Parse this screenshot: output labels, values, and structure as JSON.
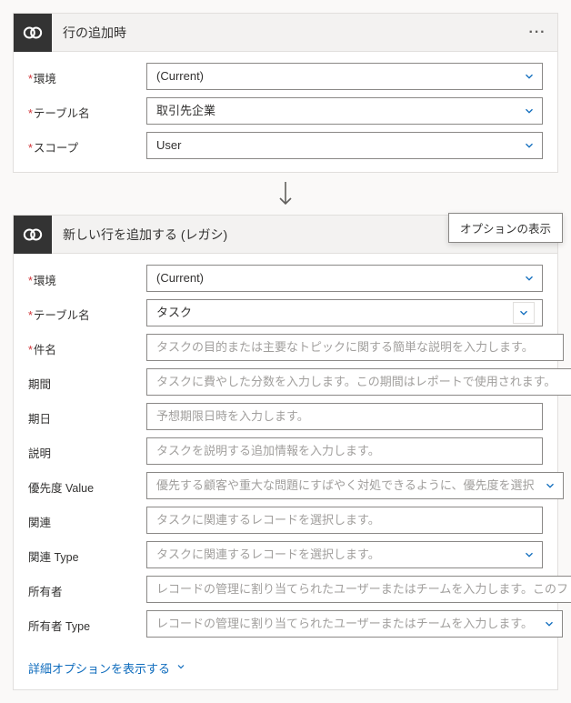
{
  "card1": {
    "title": "行の追加時",
    "fields": {
      "env": {
        "label": "環境",
        "value": "(Current)"
      },
      "table": {
        "label": "テーブル名",
        "value": "取引先企業"
      },
      "scope": {
        "label": "スコープ",
        "value": "User"
      }
    }
  },
  "card2": {
    "title": "新しい行を追加する (レガシ)",
    "tooltip": "オプションの表示",
    "fields": {
      "env": {
        "label": "環境",
        "value": "(Current)"
      },
      "table": {
        "label": "テーブル名",
        "value": "タスク"
      },
      "subject": {
        "label": "件名",
        "placeholder": "タスクの目的または主要なトピックに関する簡単な説明を入力します。"
      },
      "duration": {
        "label": "期間",
        "placeholder": "タスクに費やした分数を入力します。この期間はレポートで使用されます。"
      },
      "due": {
        "label": "期日",
        "placeholder": "予想期限日時を入力します。"
      },
      "desc": {
        "label": "説明",
        "placeholder": "タスクを説明する追加情報を入力します。"
      },
      "priority": {
        "label": "優先度 Value",
        "placeholder": "優先する顧客や重大な問題にすばやく対処できるように、優先度を選択"
      },
      "regarding": {
        "label": "関連",
        "placeholder": "タスクに関連するレコードを選択します。"
      },
      "regardingType": {
        "label": "関連 Type",
        "placeholder": "タスクに関連するレコードを選択します。"
      },
      "owner": {
        "label": "所有者",
        "placeholder": "レコードの管理に割り当てられたユーザーまたはチームを入力します。このフ"
      },
      "ownerType": {
        "label": "所有者 Type",
        "placeholder": "レコードの管理に割り当てられたユーザーまたはチームを入力します。"
      }
    },
    "advanced": "詳細オプションを表示する"
  }
}
